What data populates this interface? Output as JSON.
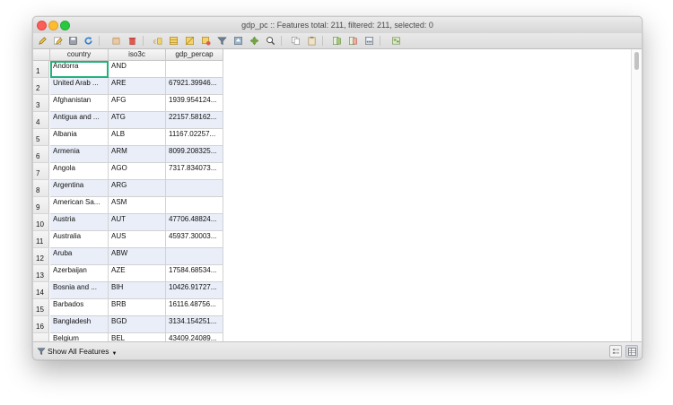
{
  "window": {
    "title": "gdp_pc :: Features total: 211, filtered: 211, selected: 0"
  },
  "toolbar": {
    "icons": [
      "edit-pencil",
      "multi-edit",
      "save-edits",
      "reload",
      "delete-selected",
      "delete-field",
      "expression-select",
      "select-all",
      "invert-selection",
      "deselect-all",
      "filter-select",
      "move-selection-top",
      "pan-map",
      "zoom-to-selection",
      "copy-rows",
      "paste-rows",
      "new-field",
      "delete-field-2",
      "field-calculator",
      "conditional-formatting"
    ]
  },
  "table": {
    "columns": [
      "country",
      "iso3c",
      "gdp_percap"
    ],
    "rows": [
      {
        "n": "1",
        "country": "Andorra",
        "iso3c": "AND",
        "gdp": ""
      },
      {
        "n": "2",
        "country": "United Arab ...",
        "iso3c": "ARE",
        "gdp": "67921.39946..."
      },
      {
        "n": "3",
        "country": "Afghanistan",
        "iso3c": "AFG",
        "gdp": "1939.954124..."
      },
      {
        "n": "4",
        "country": "Antigua and ...",
        "iso3c": "ATG",
        "gdp": "22157.58162..."
      },
      {
        "n": "5",
        "country": "Albania",
        "iso3c": "ALB",
        "gdp": "11167.02257..."
      },
      {
        "n": "6",
        "country": "Armenia",
        "iso3c": "ARM",
        "gdp": "8099.208325..."
      },
      {
        "n": "7",
        "country": "Angola",
        "iso3c": "AGO",
        "gdp": "7317.834073..."
      },
      {
        "n": "8",
        "country": "Argentina",
        "iso3c": "ARG",
        "gdp": ""
      },
      {
        "n": "9",
        "country": "American Sa...",
        "iso3c": "ASM",
        "gdp": ""
      },
      {
        "n": "10",
        "country": "Austria",
        "iso3c": "AUT",
        "gdp": "47706.48824..."
      },
      {
        "n": "11",
        "country": "Australia",
        "iso3c": "AUS",
        "gdp": "45937.30003..."
      },
      {
        "n": "12",
        "country": "Aruba",
        "iso3c": "ABW",
        "gdp": ""
      },
      {
        "n": "13",
        "country": "Azerbaijan",
        "iso3c": "AZE",
        "gdp": "17584.68534..."
      },
      {
        "n": "14",
        "country": "Bosnia and ...",
        "iso3c": "BIH",
        "gdp": "10426.91727..."
      },
      {
        "n": "15",
        "country": "Barbados",
        "iso3c": "BRB",
        "gdp": "16116.48756..."
      },
      {
        "n": "16",
        "country": "Bangladesh",
        "iso3c": "BGD",
        "gdp": "3134.154251..."
      },
      {
        "n": "",
        "country": "Belgium",
        "iso3c": "BEL",
        "gdp": "43409.24089..."
      }
    ]
  },
  "statusbar": {
    "filter_label": "Show All Features"
  }
}
